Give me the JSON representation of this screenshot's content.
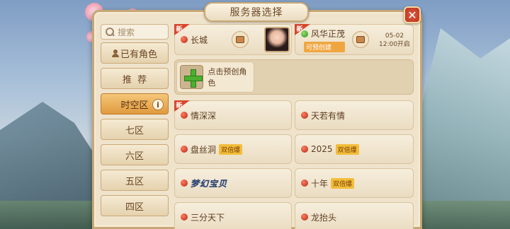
{
  "title": "服务器选择",
  "close_icon": "close-icon",
  "search": {
    "placeholder": "搜索",
    "icon": "search-icon"
  },
  "nav": [
    {
      "label": "已有角色",
      "icon": "person-icon"
    },
    {
      "label": "推  荐"
    },
    {
      "label": "时空区",
      "active": true,
      "info": "i"
    },
    {
      "label": "七区"
    },
    {
      "label": "六区"
    },
    {
      "label": "五区"
    },
    {
      "label": "四区"
    }
  ],
  "top_servers": {
    "left": {
      "badge": "新",
      "name": "长城"
    },
    "right": {
      "badge": "新",
      "name": "风华正茂",
      "status": "可预创建",
      "open_date": "05-02",
      "open_time": "12:00开启"
    }
  },
  "create": {
    "label": "点击预创角色"
  },
  "servers": [
    {
      "name": "情深深",
      "badge": "新",
      "tag": ""
    },
    {
      "name": "天若有情",
      "tag": ""
    },
    {
      "name": "盘丝洞",
      "tag": "双倍爆"
    },
    {
      "name": "2025",
      "tag": "双倍爆"
    },
    {
      "name": "梦幻宝贝",
      "logo": true,
      "tag": ""
    },
    {
      "name": "十年",
      "tag": "双倍爆"
    },
    {
      "name": "三分天下",
      "tag": ""
    },
    {
      "name": "龙抬头",
      "tag": ""
    }
  ],
  "colors": {
    "accent": "#e09a3e",
    "panel": "#efe3cc",
    "online": "#2f8f1f",
    "busy": "#b52a17"
  }
}
